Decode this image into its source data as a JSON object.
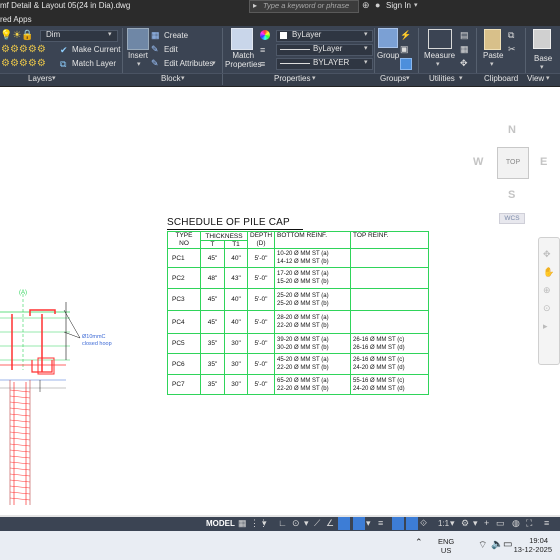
{
  "title_bar": {
    "document_title": "mf Detail & Layout 05(24 in Dia).dwg",
    "search_placeholder": "Type a keyword or phrase",
    "sign_in_label": "Sign In"
  },
  "menu_row": {
    "partial_label": "red Apps"
  },
  "ribbon": {
    "layers_panel": {
      "layer_combo_value": "Dim",
      "make_current_label": "Make Current",
      "match_layer_label": "Match Layer",
      "panel_label": "Layers"
    },
    "block_panel": {
      "insert_label": "Insert",
      "create_label": "Create",
      "edit_label": "Edit",
      "edit_attributes_label": "Edit Attributes",
      "panel_label": "Block"
    },
    "properties_panel": {
      "match_properties_label": "Match\nProperties",
      "color_combo_value": "ByLayer",
      "linetype_combo_value": "ByLayer",
      "lineweight_combo_value": "BYLAYER",
      "panel_label": "Properties"
    },
    "groups_panel": {
      "group_label": "Group",
      "panel_label": "Groups"
    },
    "utilities_panel": {
      "measure_label": "Measure",
      "panel_label": "Utilities"
    },
    "clipboard_panel": {
      "paste_label": "Paste",
      "panel_label": "Clipboard"
    },
    "view_panel": {
      "base_label": "Base",
      "panel_label": "View"
    }
  },
  "viewcube": {
    "north": "N",
    "south": "S",
    "east": "E",
    "west": "W",
    "top_face": "TOP",
    "wcs_label": "WCS"
  },
  "drawing": {
    "detail_tag": "(A)",
    "callout_line1": "Ø10mmC",
    "callout_line2": "closed hoop",
    "schedule_title": "SCHEDULE OF PILE CAP",
    "schedule": {
      "headers": {
        "type": "TYPE\nNO",
        "thickness": "THICKNESS",
        "t": "T",
        "t1": "T1",
        "depth": "DEPTH\n(D)",
        "bottom": "BOTTOM REINF.",
        "top": "TOP REINF."
      },
      "rows": [
        {
          "type": "PC1",
          "t": "45\"",
          "t1": "40\"",
          "depth": "5'-0\"",
          "bottom": "10-20 Ø MM ST (a)\n14-12 Ø MM ST (b)",
          "top": ""
        },
        {
          "type": "PC2",
          "t": "48\"",
          "t1": "43\"",
          "depth": "5'-0\"",
          "bottom": "17-20 Ø MM ST (a)\n15-20 Ø MM ST (b)",
          "top": ""
        },
        {
          "type": "PC3",
          "t": "45\"",
          "t1": "40\"",
          "depth": "5'-0\"",
          "bottom": "25-20 Ø MM ST (a)\n25-20 Ø MM ST (b)",
          "top": ""
        },
        {
          "type": "PC4",
          "t": "45\"",
          "t1": "40\"",
          "depth": "5'-0\"",
          "bottom": "28-20 Ø MM ST (a)\n22-20 Ø MM ST (b)",
          "top": ""
        },
        {
          "type": "PC5",
          "t": "35\"",
          "t1": "30\"",
          "depth": "5'-0\"",
          "bottom": "39-20 Ø MM ST (a)\n30-20 Ø MM ST (b)",
          "top": "26-16 Ø MM ST (c)\n26-16 Ø MM ST (d)"
        },
        {
          "type": "PC6",
          "t": "35\"",
          "t1": "30\"",
          "depth": "5'-0\"",
          "bottom": "45-20 Ø MM ST (a)\n22-20 Ø MM ST (b)",
          "top": "26-16 Ø MM ST (c)\n24-20 Ø MM ST (d)"
        },
        {
          "type": "PC7",
          "t": "35\"",
          "t1": "30\"",
          "depth": "5'-0\"",
          "bottom": "65-20 Ø MM ST (a)\n22-20 Ø MM ST (b)",
          "top": "55-16 Ø MM ST (c)\n24-20 Ø MM ST (d)"
        }
      ]
    }
  },
  "status_bar": {
    "model_label": "MODEL",
    "scale_label": "1:1"
  },
  "taskbar": {
    "language_line1": "ENG",
    "language_line2": "US",
    "time": "19:04",
    "date": "13-12-2025"
  },
  "colors": {
    "ribbon_bg": "#3b4453",
    "title_bg": "#2b2b2b",
    "table_border": "#2fd45a",
    "rebar_red": "#e0202a",
    "rebar_green": "#2fd45a",
    "status_active_blue": "#3d7dd6"
  }
}
